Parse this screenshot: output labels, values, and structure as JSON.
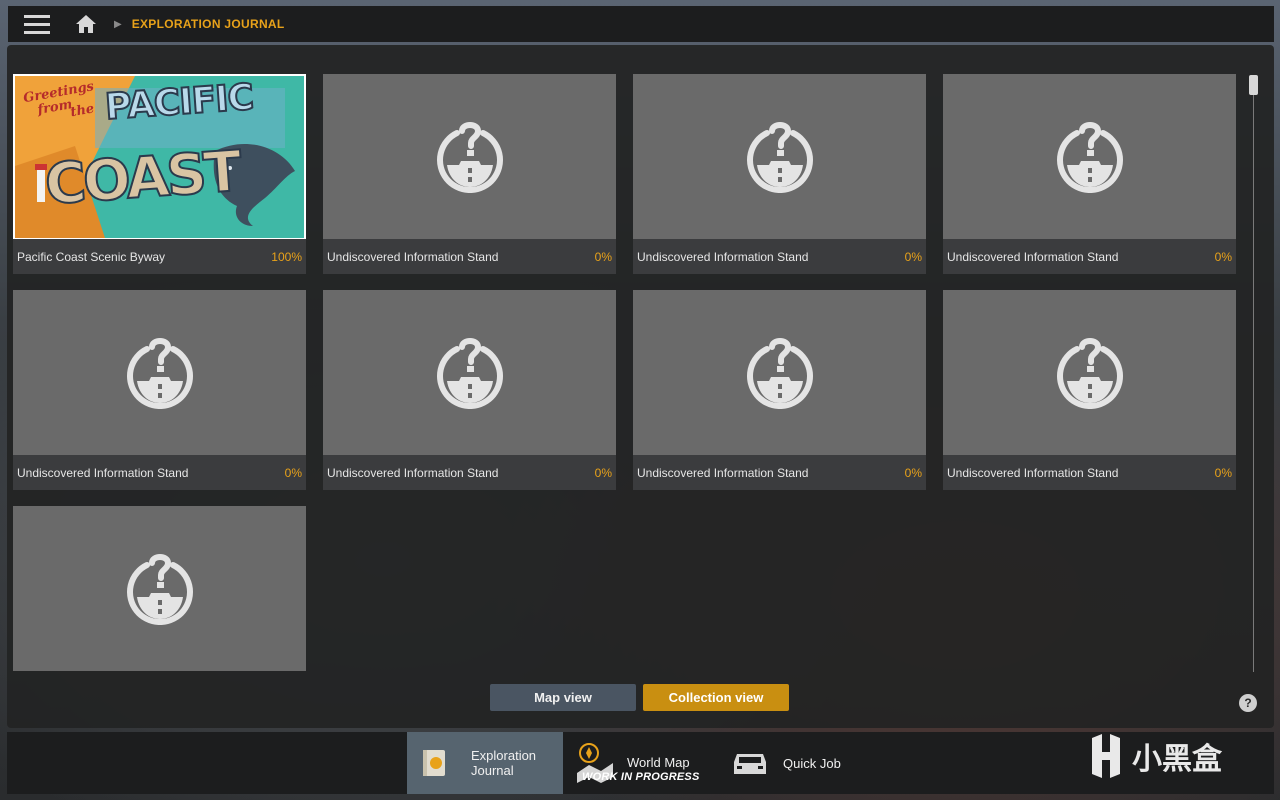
{
  "breadcrumb": {
    "title": "EXPLORATION JOURNAL"
  },
  "icons": {
    "menu": "hamburger-icon",
    "home": "home-icon",
    "arrow": "chevron-right-icon",
    "unknown": "undiscovered-stand-icon",
    "help": "help-icon"
  },
  "cards": [
    {
      "name": "Pacific Coast Scenic Byway",
      "percent": "100%",
      "discovered": true
    },
    {
      "name": "Undiscovered Information Stand",
      "percent": "0%",
      "discovered": false
    },
    {
      "name": "Undiscovered Information Stand",
      "percent": "0%",
      "discovered": false
    },
    {
      "name": "Undiscovered Information Stand",
      "percent": "0%",
      "discovered": false
    },
    {
      "name": "Undiscovered Information Stand",
      "percent": "0%",
      "discovered": false
    },
    {
      "name": "Undiscovered Information Stand",
      "percent": "0%",
      "discovered": false
    },
    {
      "name": "Undiscovered Information Stand",
      "percent": "0%",
      "discovered": false
    },
    {
      "name": "Undiscovered Information Stand",
      "percent": "0%",
      "discovered": false
    },
    {
      "name": "",
      "percent": "",
      "discovered": false
    }
  ],
  "postcard": {
    "greeting_line1": "Greetings",
    "greeting_line2": "from",
    "greeting_line3": "the",
    "word1": "PACIFIC",
    "word2": "COAST"
  },
  "views": {
    "map": "Map view",
    "collection": "Collection view"
  },
  "help_label": "?",
  "bottom_nav": {
    "journal_line1": "Exploration",
    "journal_line2": "Journal",
    "world_map": "World Map",
    "wip": "WORK IN PROGRESS",
    "quick_job": "Quick Job"
  },
  "watermark": "小黑盒",
  "colors": {
    "accent": "#e8a21a",
    "collection_button": "#c98f11",
    "map_button": "#4a5562",
    "active_tab": "#56646f"
  }
}
